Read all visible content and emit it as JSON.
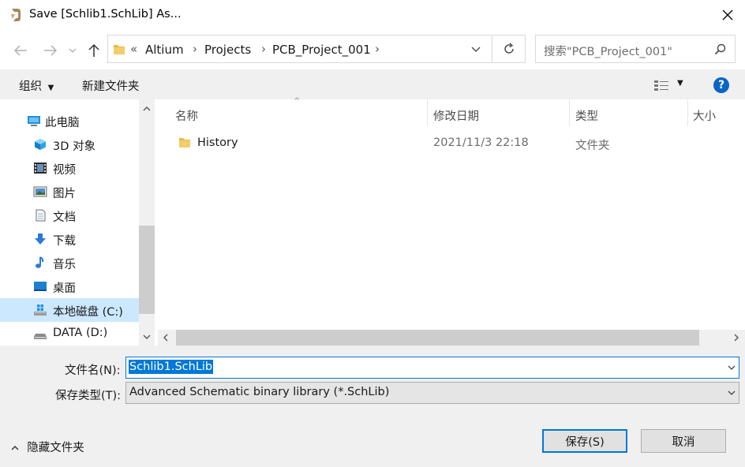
{
  "window": {
    "title": "Save [Schlib1.SchLib] As..."
  },
  "nav": {
    "breadcrumb": [
      "Altium",
      "Projects",
      "PCB_Project_001"
    ],
    "overflow_glyph": "«",
    "search_placeholder": "搜索\"PCB_Project_001\""
  },
  "toolbar": {
    "organize_label": "组织",
    "new_folder_label": "新建文件夹"
  },
  "sidebar": {
    "items": [
      {
        "label": "此电脑",
        "icon": "computer-icon"
      },
      {
        "label": "3D 对象",
        "icon": "cube-3d-icon"
      },
      {
        "label": "视频",
        "icon": "video-icon"
      },
      {
        "label": "图片",
        "icon": "picture-icon"
      },
      {
        "label": "文档",
        "icon": "document-icon"
      },
      {
        "label": "下载",
        "icon": "download-icon"
      },
      {
        "label": "音乐",
        "icon": "music-icon"
      },
      {
        "label": "桌面",
        "icon": "desktop-icon"
      },
      {
        "label": "本地磁盘 (C:)",
        "icon": "windows-drive-icon",
        "selected": true
      },
      {
        "label": "DATA (D:)",
        "icon": "drive-icon"
      }
    ]
  },
  "files": {
    "columns": [
      "名称",
      "修改日期",
      "类型",
      "大小"
    ],
    "rows": [
      {
        "name": "History",
        "modified": "2021/11/3 22:18",
        "type": "文件夹",
        "size": ""
      }
    ]
  },
  "form": {
    "filename_label": "文件名(N):",
    "filename_value": "Schlib1.SchLib",
    "filetype_label": "保存类型(T):",
    "filetype_value": "Advanced Schematic binary library (*.SchLib)"
  },
  "footer": {
    "hide_folders_label": "隐藏文件夹",
    "save_label": "保存(S)",
    "cancel_label": "取消"
  },
  "colors": {
    "accent": "#0078d7",
    "selection_bg": "#cce8ff",
    "folder": "#e8b94a"
  }
}
